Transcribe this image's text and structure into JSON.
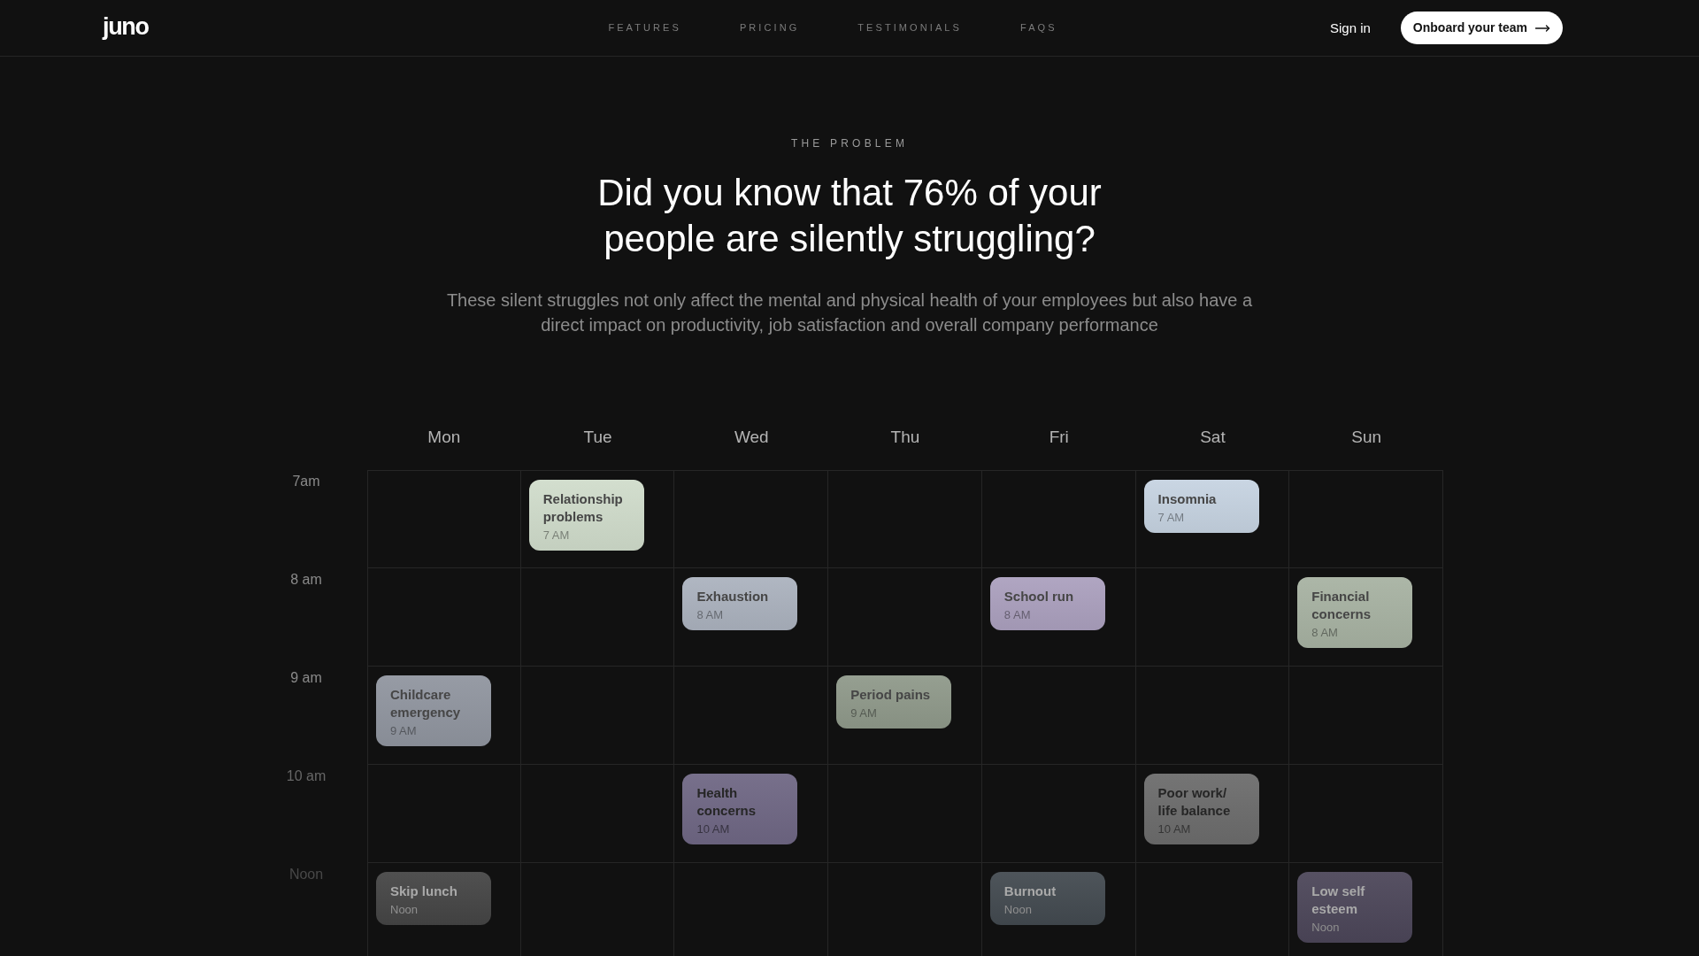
{
  "nav": {
    "logo": "juno",
    "links": [
      "FEATURES",
      "PRICING",
      "TESTIMONIALS",
      "FAQS"
    ],
    "sign_in": "Sign in",
    "cta": "Onboard your team"
  },
  "section": {
    "eyebrow": "THE PROBLEM",
    "heading": "Did you know that 76% of your people are silently struggling?",
    "description": "These silent struggles not only affect the mental and physical health of your employees but also have a direct impact on productivity, job satisfaction and overall company performance"
  },
  "calendar": {
    "days": [
      "Mon",
      "Tue",
      "Wed",
      "Thu",
      "Fri",
      "Sat",
      "Sun"
    ],
    "rows": [
      {
        "time": "7am",
        "cells": [
          {
            "kind": "empty"
          },
          {
            "kind": "event",
            "title": "Relationship problems",
            "time": "7 AM",
            "color": "#d0dccb"
          },
          {
            "kind": "empty"
          },
          {
            "kind": "empty"
          },
          {
            "kind": "empty"
          },
          {
            "kind": "event",
            "title": "Insomnia",
            "time": "7 AM",
            "color": "#c6d3e1"
          },
          {
            "kind": "empty"
          }
        ]
      },
      {
        "time": "8 am",
        "cells": [
          {
            "kind": "empty"
          },
          {
            "kind": "empty"
          },
          {
            "kind": "event",
            "title": "Exhaustion",
            "time": "8 AM",
            "color": "#abb2be"
          },
          {
            "kind": "empty"
          },
          {
            "kind": "event",
            "title": "School run",
            "time": "8 AM",
            "color": "#aba0be"
          },
          {
            "kind": "empty"
          },
          {
            "kind": "event",
            "title": "Financial concerns",
            "time": "8 AM",
            "color": "#a7b2a2"
          }
        ]
      },
      {
        "time": "9 am",
        "cells": [
          {
            "kind": "event",
            "title": "Childcare emergency",
            "time": "9 AM",
            "color": "#90959f"
          },
          {
            "kind": "empty"
          },
          {
            "kind": "empty"
          },
          {
            "kind": "event",
            "title": "Period pains",
            "time": "9 AM",
            "color": "#8f998a"
          },
          {
            "kind": "empty"
          },
          {
            "kind": "empty"
          },
          {
            "kind": "empty"
          }
        ]
      },
      {
        "time": "10 am",
        "cells": [
          {
            "kind": "empty"
          },
          {
            "kind": "empty"
          },
          {
            "kind": "event",
            "title": "Health concerns",
            "time": "10 AM",
            "color": "#6f6784"
          },
          {
            "kind": "empty"
          },
          {
            "kind": "empty"
          },
          {
            "kind": "event",
            "title": "Poor work/ life balance",
            "time": "10 AM",
            "color": "#6c6c6c"
          },
          {
            "kind": "empty"
          }
        ]
      },
      {
        "time": "Noon",
        "cells": [
          {
            "kind": "event",
            "title": "Skip lunch",
            "time": "Noon",
            "color": "#454545"
          },
          {
            "kind": "empty"
          },
          {
            "kind": "empty"
          },
          {
            "kind": "empty"
          },
          {
            "kind": "event",
            "title": "Burnout",
            "time": "Noon",
            "color": "#434a50"
          },
          {
            "kind": "empty"
          },
          {
            "kind": "event",
            "title": "Low self esteem",
            "time": "Noon",
            "color": "#4c4659"
          }
        ]
      }
    ]
  }
}
